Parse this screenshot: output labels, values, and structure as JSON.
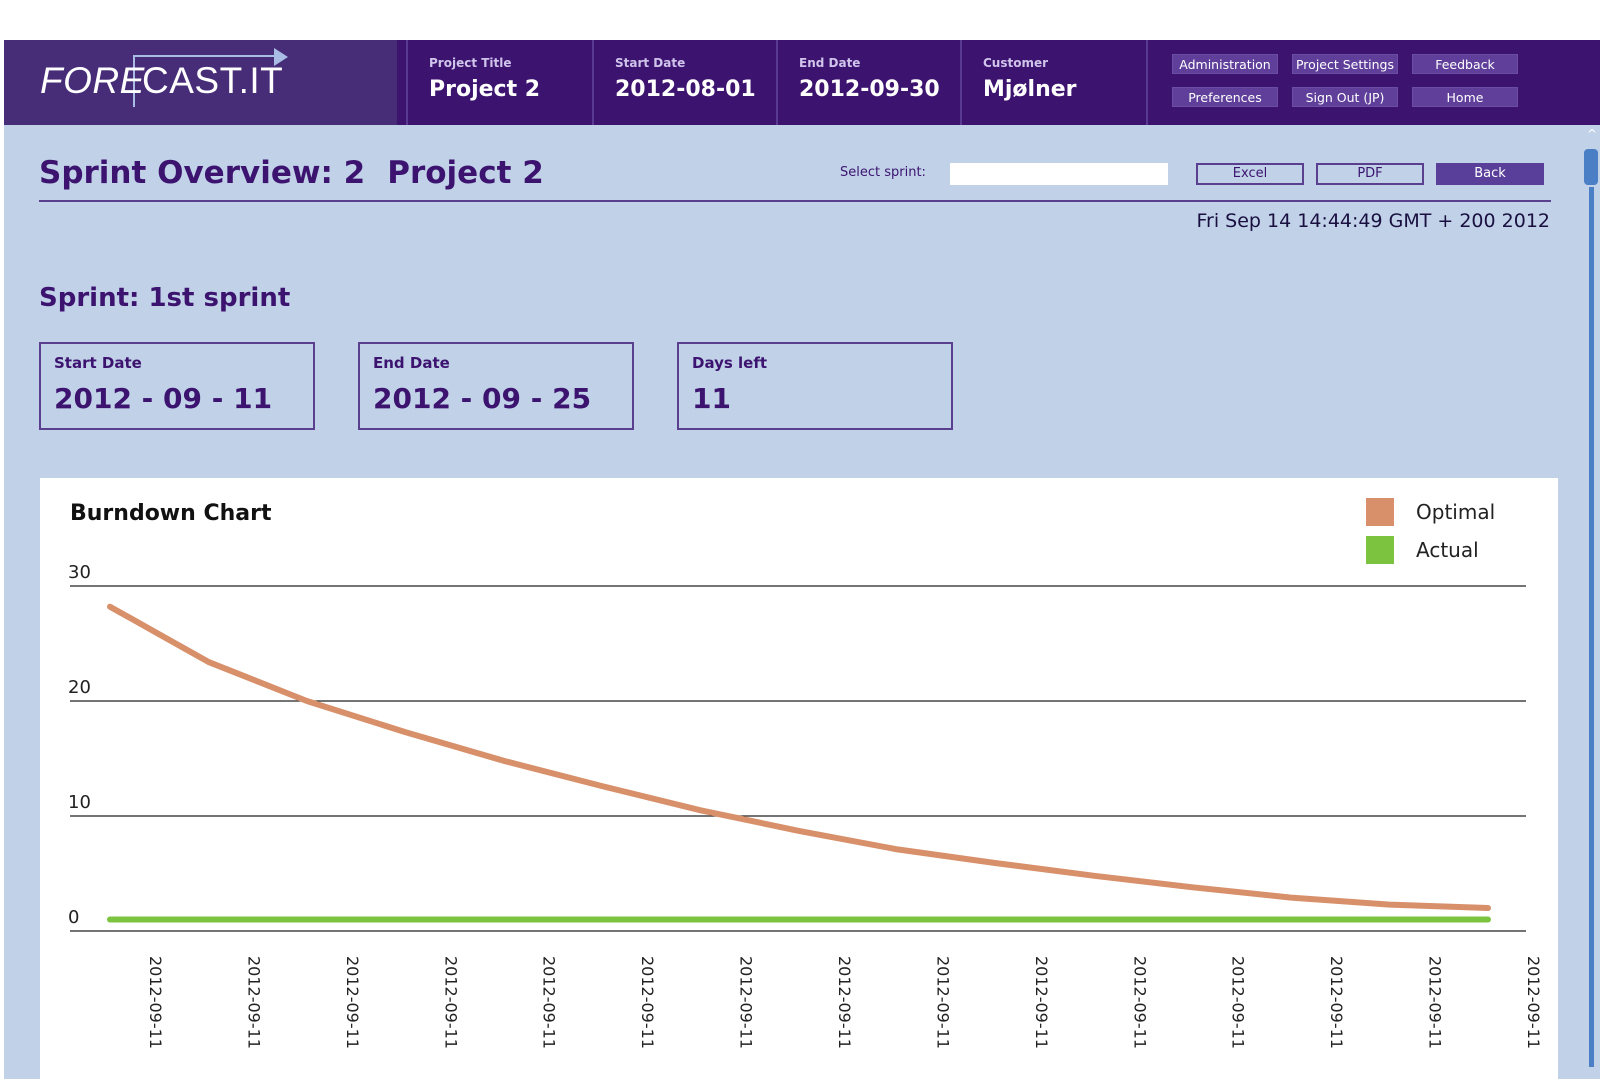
{
  "header": {
    "logo_left": "FORE",
    "logo_right": "CAST.IT",
    "project_title_label": "Project Title",
    "project_title": "Project 2",
    "start_date_label": "Start Date",
    "start_date": "2012-08-01",
    "end_date_label": "End Date",
    "end_date": "2012-09-30",
    "customer_label": "Customer",
    "customer": "Mjølner",
    "nav": {
      "administration": "Administration",
      "project_settings": "Project Settings",
      "feedback": "Feedback",
      "preferences": "Preferences",
      "sign_out": "Sign Out (JP)",
      "home": "Home"
    }
  },
  "main": {
    "title_prefix": "Sprint Overview: 2",
    "title_project": "Project 2",
    "select_sprint_label": "Select sprint:",
    "select_sprint_value": "",
    "excel_label": "Excel",
    "pdf_label": "PDF",
    "back_label": "Back",
    "datetime": "Fri Sep 14  14:44:49 GMT + 200  2012",
    "sprint_name": "Sprint: 1st sprint",
    "boxes": {
      "start_label": "Start Date",
      "start_value": "2012 - 09 - 11",
      "end_label": "End Date",
      "end_value": "2012 - 09 - 25",
      "days_label": "Days left",
      "days_value": "11"
    }
  },
  "chart_data": {
    "type": "line",
    "title": "Burndown Chart",
    "x": [
      "2012-09-11",
      "2012-09-11",
      "2012-09-11",
      "2012-09-11",
      "2012-09-11",
      "2012-09-11",
      "2012-09-11",
      "2012-09-11",
      "2012-09-11",
      "2012-09-11",
      "2012-09-11",
      "2012-09-11",
      "2012-09-11",
      "2012-09-11",
      "2012-09-11"
    ],
    "series": [
      {
        "name": "Optimal",
        "color": "#d8906b",
        "values": [
          28.2,
          23.4,
          20.0,
          17.3,
          14.8,
          12.6,
          10.5,
          8.7,
          7.1,
          5.9,
          4.8,
          3.8,
          2.9,
          2.3,
          2.0
        ]
      },
      {
        "name": "Actual",
        "color": "#7cc440",
        "values": [
          1,
          1,
          1,
          1,
          1,
          1,
          1,
          1,
          1,
          1,
          1,
          1,
          1,
          1,
          1
        ]
      }
    ],
    "yticks": [
      0,
      10,
      20,
      30
    ],
    "ylim": [
      0,
      30
    ],
    "grid": true,
    "legend": "top-right"
  }
}
